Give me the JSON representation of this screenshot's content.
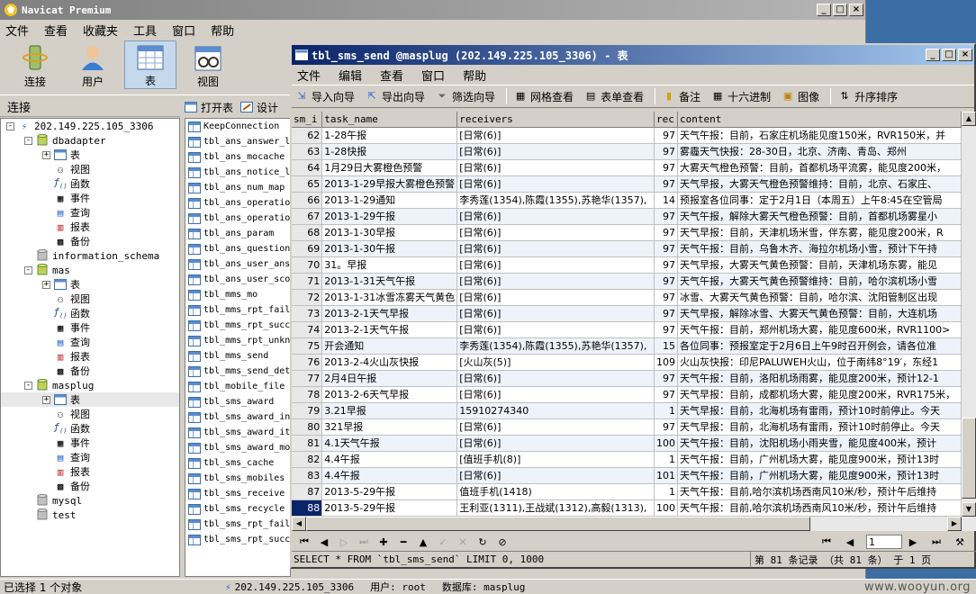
{
  "app": {
    "title": "Navicat Premium",
    "menu": [
      "文件",
      "查看",
      "收藏夹",
      "工具",
      "窗口",
      "帮助"
    ],
    "toolbar": [
      {
        "label": "连接",
        "icon": "connection-icon"
      },
      {
        "label": "用户",
        "icon": "user-icon"
      },
      {
        "label": "表",
        "icon": "table-icon"
      },
      {
        "label": "视图",
        "icon": "view-icon"
      }
    ]
  },
  "sidebar": {
    "header": "连接",
    "tree": [
      {
        "level": 0,
        "label": "202.149.225.105_3306",
        "icon": "server-icon",
        "expander": "−"
      },
      {
        "level": 1,
        "label": "dbadapter",
        "icon": "database-icon",
        "expander": "−"
      },
      {
        "level": 2,
        "label": "表",
        "icon": "table-icon",
        "expander": "+"
      },
      {
        "level": 2,
        "label": "视图",
        "icon": "view-icon",
        "expander": ""
      },
      {
        "level": 2,
        "label": "函数",
        "icon": "function-icon",
        "expander": ""
      },
      {
        "level": 2,
        "label": "事件",
        "icon": "event-icon",
        "expander": ""
      },
      {
        "level": 2,
        "label": "查询",
        "icon": "query-icon",
        "expander": ""
      },
      {
        "level": 2,
        "label": "报表",
        "icon": "report-icon",
        "expander": ""
      },
      {
        "level": 2,
        "label": "备份",
        "icon": "backup-icon",
        "expander": ""
      },
      {
        "level": 1,
        "label": "information_schema",
        "icon": "database-gray-icon",
        "expander": ""
      },
      {
        "level": 1,
        "label": "mas",
        "icon": "database-icon",
        "expander": "−"
      },
      {
        "level": 2,
        "label": "表",
        "icon": "table-icon",
        "expander": "+"
      },
      {
        "level": 2,
        "label": "视图",
        "icon": "view-icon",
        "expander": ""
      },
      {
        "level": 2,
        "label": "函数",
        "icon": "function-icon",
        "expander": ""
      },
      {
        "level": 2,
        "label": "事件",
        "icon": "event-icon",
        "expander": ""
      },
      {
        "level": 2,
        "label": "查询",
        "icon": "query-icon",
        "expander": ""
      },
      {
        "level": 2,
        "label": "报表",
        "icon": "report-icon",
        "expander": ""
      },
      {
        "level": 2,
        "label": "备份",
        "icon": "backup-icon",
        "expander": ""
      },
      {
        "level": 1,
        "label": "masplug",
        "icon": "database-icon",
        "expander": "−"
      },
      {
        "level": 2,
        "label": "表",
        "icon": "table-icon",
        "expander": "+",
        "selected": true
      },
      {
        "level": 2,
        "label": "视图",
        "icon": "view-icon",
        "expander": ""
      },
      {
        "level": 2,
        "label": "函数",
        "icon": "function-icon",
        "expander": ""
      },
      {
        "level": 2,
        "label": "事件",
        "icon": "event-icon",
        "expander": ""
      },
      {
        "level": 2,
        "label": "查询",
        "icon": "query-icon",
        "expander": ""
      },
      {
        "level": 2,
        "label": "报表",
        "icon": "report-icon",
        "expander": ""
      },
      {
        "level": 2,
        "label": "备份",
        "icon": "backup-icon",
        "expander": ""
      },
      {
        "level": 1,
        "label": "mysql",
        "icon": "database-gray-icon",
        "expander": ""
      },
      {
        "level": 1,
        "label": "test",
        "icon": "database-gray-icon",
        "expander": ""
      }
    ]
  },
  "objects": {
    "open_label": "打开表",
    "design_label": "设计",
    "items": [
      "KeepConnection",
      "tbl_ans_answer_l",
      "tbl_ans_mocache",
      "tbl_ans_notice_l",
      "tbl_ans_num_map",
      "tbl_ans_operatio",
      "tbl_ans_operatio",
      "tbl_ans_param",
      "tbl_ans_question",
      "tbl_ans_user_ans",
      "tbl_ans_user_sco",
      "tbl_mms_mo",
      "tbl_mms_rpt_fail",
      "tbl_mms_rpt_succ",
      "tbl_mms_rpt_unkn",
      "tbl_mms_send",
      "tbl_mms_send_det",
      "tbl_mobile_file",
      "tbl_sms_award",
      "tbl_sms_award_in",
      "tbl_sms_award_it",
      "tbl_sms_award_mo",
      "tbl_sms_cache",
      "tbl_sms_mobiles",
      "tbl_sms_receive",
      "tbl_sms_recycle",
      "tbl_sms_rpt_fail",
      "tbl_sms_rpt_succ"
    ]
  },
  "table_window": {
    "title": "tbl_sms_send @masplug (202.149.225.105_3306) - 表",
    "menu": [
      "文件",
      "编辑",
      "查看",
      "窗口",
      "帮助"
    ],
    "tools": [
      {
        "label": "导入向导",
        "icon": "import-icon"
      },
      {
        "label": "导出向导",
        "icon": "export-icon"
      },
      {
        "label": "筛选向导",
        "icon": "filter-icon"
      },
      {
        "label": "网格查看",
        "icon": "grid-view-icon"
      },
      {
        "label": "表单查看",
        "icon": "form-view-icon"
      },
      {
        "label": "备注",
        "icon": "memo-icon"
      },
      {
        "label": "十六进制",
        "icon": "hex-icon"
      },
      {
        "label": "图像",
        "icon": "image-icon"
      },
      {
        "label": "升序排序",
        "icon": "sort-asc-icon"
      }
    ],
    "columns": [
      "sm_i",
      "task_name",
      "receivers",
      "rec",
      "content"
    ],
    "rows": [
      {
        "id": "62",
        "task": "1-28午报",
        "receivers": "[日常(6)]",
        "rec": "97",
        "content": "天气午报：目前，石家庄机场能见度150米，RVR150米，并"
      },
      {
        "id": "63",
        "task": "1-28快报",
        "receivers": "[日常(6)]",
        "rec": "97",
        "content": "雾霾天气快报：28-30日，北京、济南、青岛、郑州"
      },
      {
        "id": "64",
        "task": "1月29日大雾橙色预警",
        "receivers": "[日常(6)]",
        "rec": "97",
        "content": "大雾天气橙色预警：目前，首都机场平流雾，能见度200米，"
      },
      {
        "id": "65",
        "task": "2013-1-29早报大雾橙色预警",
        "receivers": "[日常(6)]",
        "rec": "97",
        "content": "天气早报，大雾天气橙色预警维持：目前，北京、石家庄、"
      },
      {
        "id": "66",
        "task": "2013-1-29通知",
        "receivers": "李秀莲(1354),陈霞(1355),苏艳华(1357),",
        "rec": "14",
        "content": "预报室各位同事：定于2月1日（本周五）上午8:45在空管局"
      },
      {
        "id": "67",
        "task": "2013-1-29午报",
        "receivers": "[日常(6)]",
        "rec": "97",
        "content": "天气午报，解除大雾天气橙色预警：目前，首都机场雾星小"
      },
      {
        "id": "68",
        "task": "2013-1-30早报",
        "receivers": "[日常(6)]",
        "rec": "97",
        "content": "天气早报：目前，天津机场米雪，伴东雾，能见度200米，R"
      },
      {
        "id": "69",
        "task": "2013-1-30午报",
        "receivers": "[日常(6)]",
        "rec": "97",
        "content": "天气午报：目前，乌鲁木齐、海拉尔机场小雪，预计下午持"
      },
      {
        "id": "70",
        "task": "31。早报",
        "receivers": "[日常(6)]",
        "rec": "97",
        "content": "天气早报，大雾天气黄色预警：目前，天津机场东雾，能见"
      },
      {
        "id": "71",
        "task": "2013-1-31天气午报",
        "receivers": "[日常(6)]",
        "rec": "97",
        "content": "天气午报，大雾天气黄色预警维持：目前，哈尔滨机场小雪"
      },
      {
        "id": "72",
        "task": "2013-1-31冰雪冻雾天气黄色",
        "receivers": "[日常(6)]",
        "rec": "97",
        "content": "冰雪、大雾天气黄色预警：目前，哈尔滨、沈阳管制区出现"
      },
      {
        "id": "73",
        "task": "2013-2-1天气早报",
        "receivers": "[日常(6)]",
        "rec": "97",
        "content": "天气早报，解除冰雪、大雾天气黄色预警：目前，大连机场"
      },
      {
        "id": "74",
        "task": "2013-2-1天气午报",
        "receivers": "[日常(6)]",
        "rec": "97",
        "content": "天气午报：目前，郑州机场大雾，能见度600米，RVR1100>"
      },
      {
        "id": "75",
        "task": "开会通知",
        "receivers": "李秀莲(1354),陈霞(1355),苏艳华(1357),",
        "rec": "15",
        "content": "各位同事：预报室定于2月6日上午9时召开例会，请各位准"
      },
      {
        "id": "76",
        "task": "2013-2-4火山灰快报",
        "receivers": "[火山灰(5)]",
        "rec": "109",
        "content": "火山灰快报：印尼PALUWEH火山，位于南纬8°19′，东经1"
      },
      {
        "id": "77",
        "task": "2月4日午报",
        "receivers": "[日常(6)]",
        "rec": "97",
        "content": "天气午报：目前，洛阳机场雨雾，能见度200米，预计12-1"
      },
      {
        "id": "78",
        "task": "2013-2-6天气早报",
        "receivers": "[日常(6)]",
        "rec": "97",
        "content": "天气早报：目前，成都机场大雾，能见度200米，RVR175米，"
      },
      {
        "id": "79",
        "task": "3.21早报",
        "receivers": "15910274340",
        "rec": "1",
        "content": "天气早报：目前，北海机场有雷雨，预计10时前停止。今天"
      },
      {
        "id": "80",
        "task": "321早报",
        "receivers": "[日常(6)]",
        "rec": "97",
        "content": "天气早报：目前，北海机场有雷雨，预计10时前停止。今天"
      },
      {
        "id": "81",
        "task": "4.1天气午报",
        "receivers": "[日常(6)]",
        "rec": "100",
        "content": "天气午报：目前，沈阳机场小雨夹雪，能见度400米，预计"
      },
      {
        "id": "82",
        "task": "4.4午报",
        "receivers": "[值班手机(8)]",
        "rec": "1",
        "content": "天气午报：目前，广州机场大雾，能见度900米，预计13时"
      },
      {
        "id": "83",
        "task": "4.4午报",
        "receivers": "[日常(6)]",
        "rec": "101",
        "content": "天气午报：目前，广州机场大雾，能见度900米，预计13时"
      },
      {
        "id": "87",
        "task": "2013-5-29午报",
        "receivers": "值班手机(1418)",
        "rec": "1",
        "content": "天气午报：目前,哈尔滨机场西南风10米/秒，预计午后维持"
      },
      {
        "id": "88",
        "task": "2013-5-29午报",
        "receivers": "王利亚(1311),王战斌(1312),高毅(1313),",
        "rec": "100",
        "content": "天气午报：目前,哈尔滨机场西南风10米/秒，预计午后维持"
      }
    ],
    "pager_value": "1",
    "sql": "SELECT * FROM `tbl_sms_send` LIMIT 0, 1000",
    "record_info": "第 81 条记录 （共 81 条） 于 1 页"
  },
  "status": {
    "selected": "已选择 1 个对象",
    "connection": "202.149.225.105_3306",
    "user": "用户: root",
    "database": "数据库: masplug",
    "watermark": "www.wooyun.org"
  }
}
